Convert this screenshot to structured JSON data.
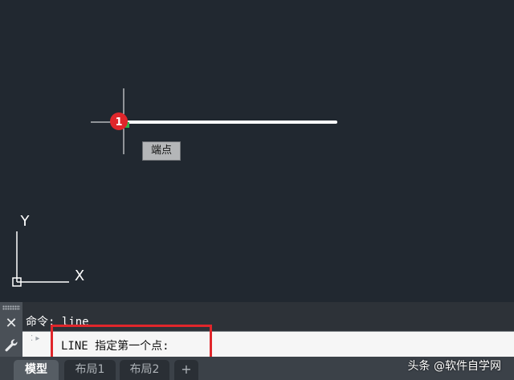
{
  "canvas": {
    "background": "#212830",
    "snap_tooltip": "端点",
    "step_marker": "1",
    "ucs": {
      "y_label": "Y",
      "x_label": "X"
    }
  },
  "command": {
    "history_line": "命令:  line",
    "prompt": "LINE 指定第一个点:",
    "close_icon": "close-icon",
    "customize_icon": "wrench-icon"
  },
  "tabs": [
    {
      "label": "模型",
      "active": true
    },
    {
      "label": "布局1",
      "active": false
    },
    {
      "label": "布局2",
      "active": false
    },
    {
      "label": "+",
      "active": false
    }
  ],
  "watermark": "头条 @软件自学网",
  "colors": {
    "highlight": "#e0262b",
    "marker": "#e0262b",
    "line": "#ffffff"
  }
}
